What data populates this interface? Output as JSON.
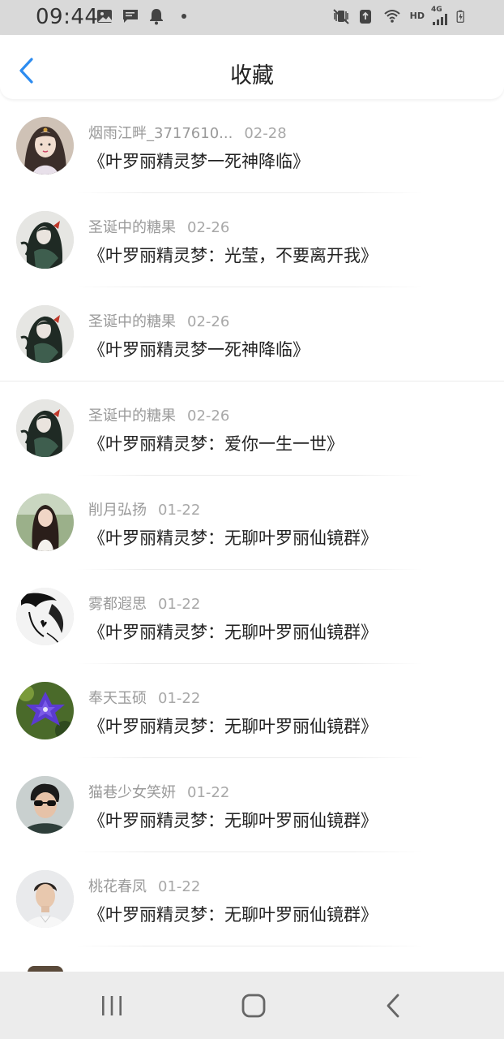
{
  "status_bar": {
    "time": "09:44",
    "network_label": "HD",
    "network_gen": "4G"
  },
  "header": {
    "title": "收藏"
  },
  "items": [
    {
      "name": "烟雨江畔_3717610...",
      "date": "02-28",
      "title": "《叶罗丽精灵梦一死神降临》",
      "avatar": "girl-portrait"
    },
    {
      "name": "圣诞中的糖果",
      "date": "02-26",
      "title": "《叶罗丽精灵梦：光莹，不要离开我》",
      "avatar": "doll-dark"
    },
    {
      "name": "圣诞中的糖果",
      "date": "02-26",
      "title": "《叶罗丽精灵梦一死神降临》",
      "avatar": "doll-dark"
    },
    {
      "name": "圣诞中的糖果",
      "date": "02-26",
      "title": "《叶罗丽精灵梦：爱你一生一世》",
      "avatar": "doll-dark"
    },
    {
      "name": "削月弘扬",
      "date": "01-22",
      "title": "《叶罗丽精灵梦：无聊叶罗丽仙镜群》",
      "avatar": "girl-photo"
    },
    {
      "name": "雾都遐思",
      "date": "01-22",
      "title": "《叶罗丽精灵梦：无聊叶罗丽仙镜群》",
      "avatar": "ink-sketch"
    },
    {
      "name": "奉天玉硕",
      "date": "01-22",
      "title": "《叶罗丽精灵梦：无聊叶罗丽仙镜群》",
      "avatar": "purple-flower"
    },
    {
      "name": "猫巷少女笑妍",
      "date": "01-22",
      "title": "《叶罗丽精灵梦：无聊叶罗丽仙镜群》",
      "avatar": "boy-sunglasses"
    },
    {
      "name": "桃花春凤",
      "date": "01-22",
      "title": "《叶罗丽精灵梦：无聊叶罗丽仙镜群》",
      "avatar": "man-portrait"
    }
  ],
  "nav_bar": {
    "recents_icon": "recents-icon",
    "home_icon": "home-icon",
    "back_icon": "back-icon"
  },
  "colors": {
    "accent": "#2d8cf0",
    "status_bar_bg": "#d9d9d9",
    "nav_bar_bg": "#ececec",
    "meta_text": "#9a9a9a",
    "title_text": "#222222"
  }
}
